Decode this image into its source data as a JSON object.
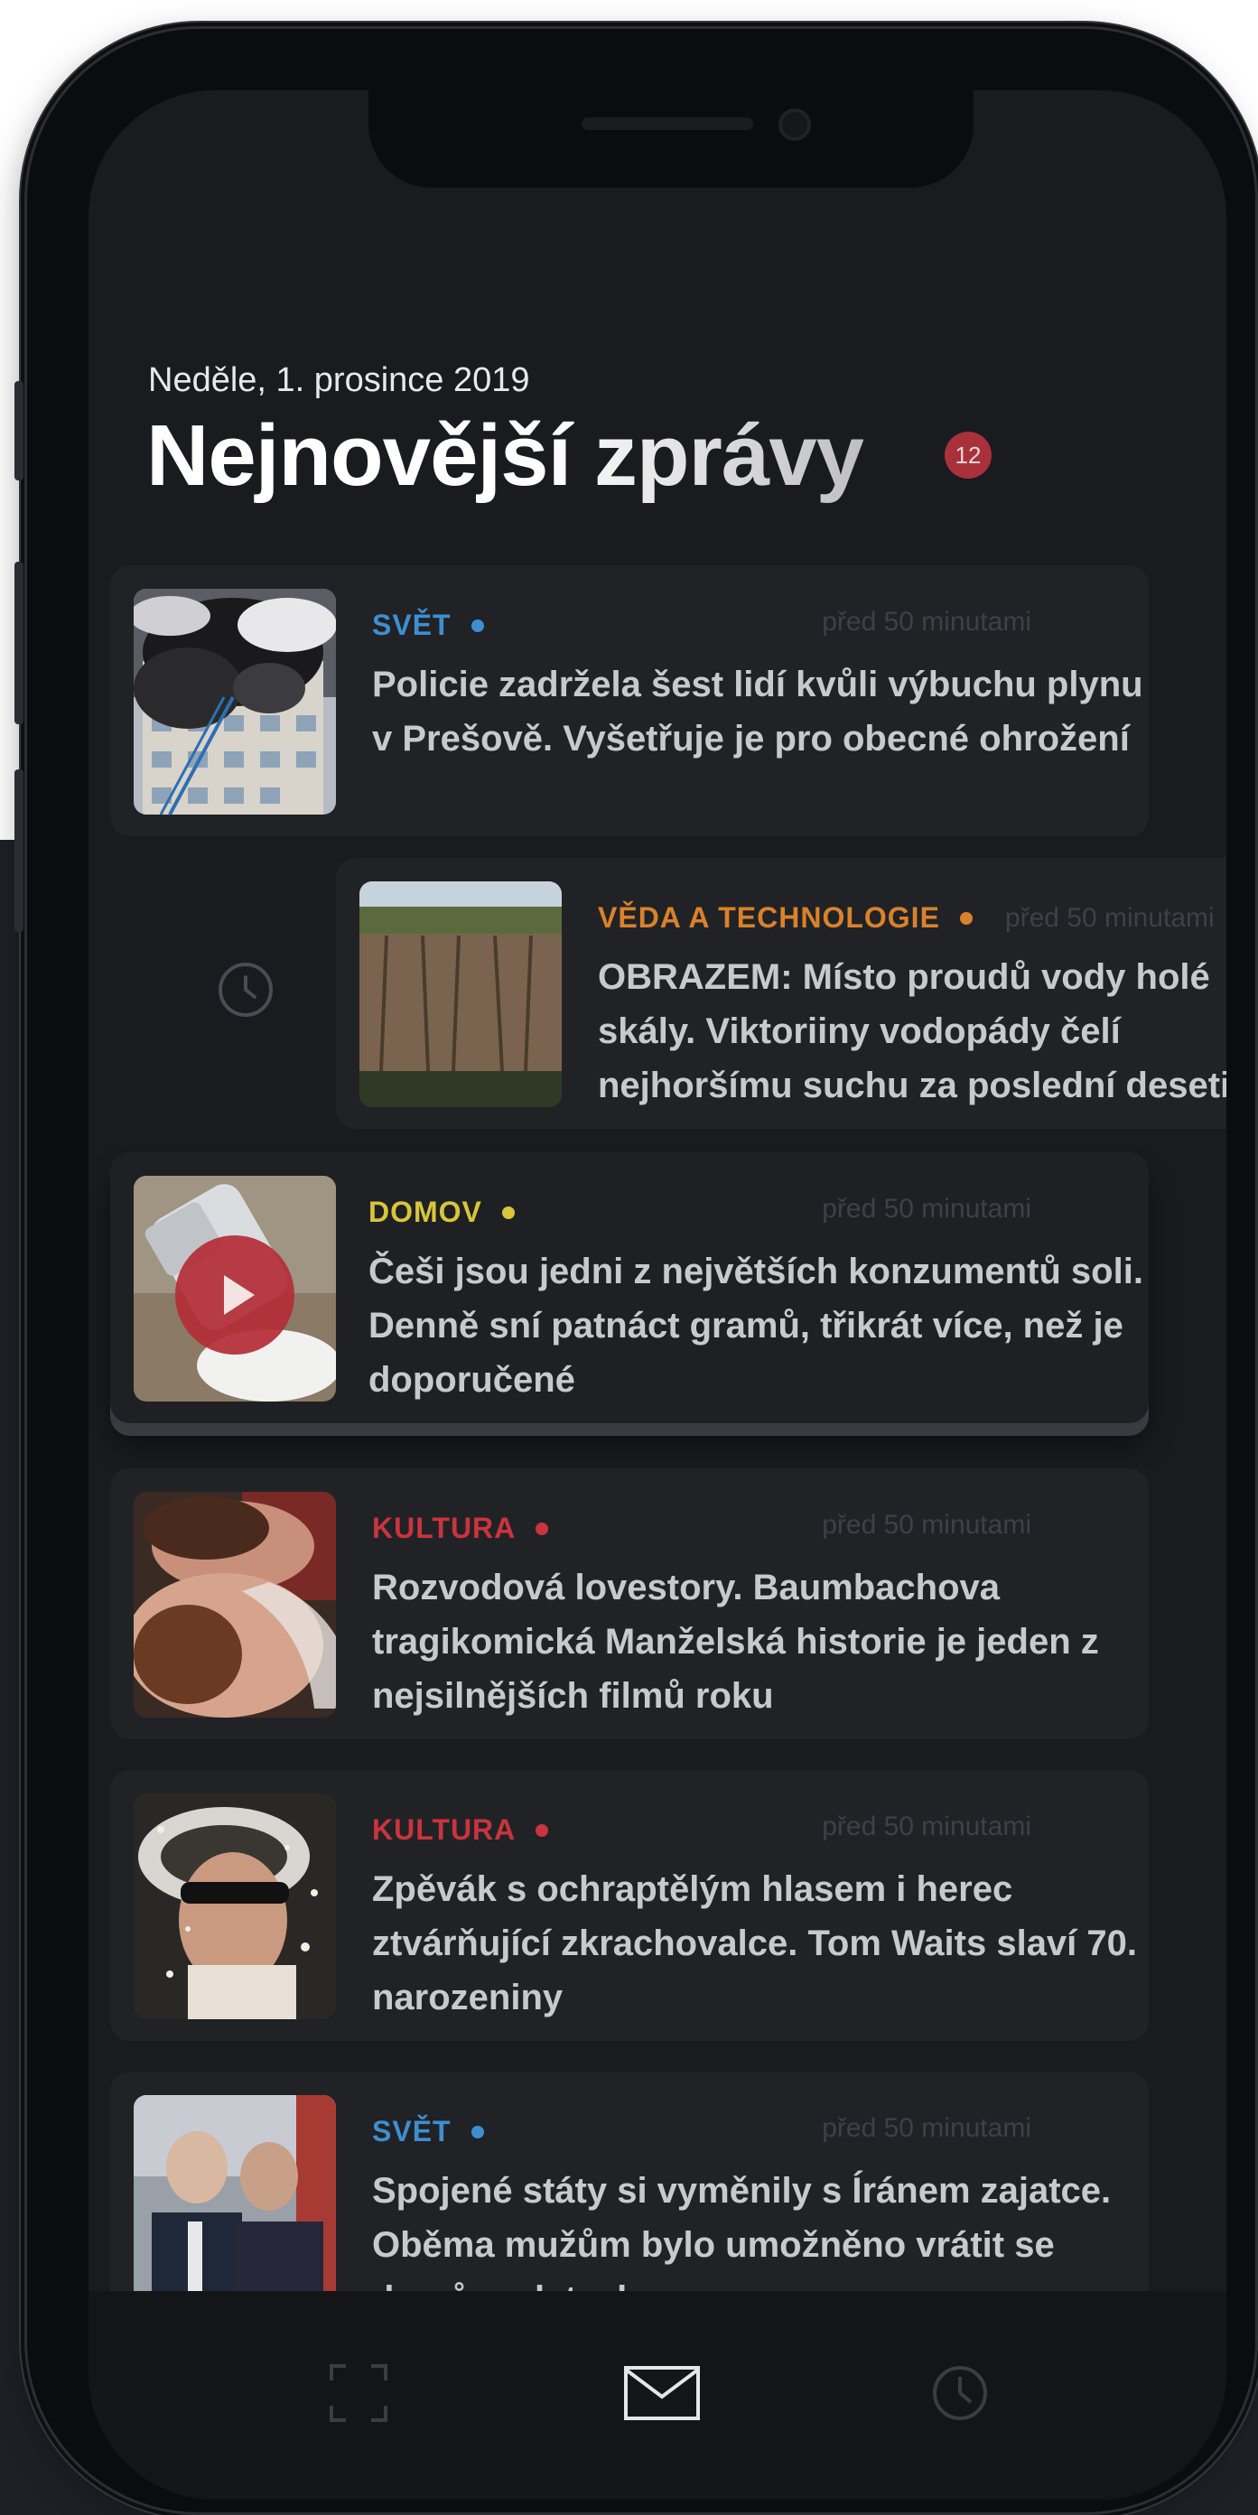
{
  "header": {
    "date": "Neděle, 1. prosince 2019",
    "title": "Nejnovější zprávy",
    "badge_count": "12"
  },
  "articles": [
    {
      "category": "SVĚT",
      "category_color": "#3d8fd0",
      "time": "před 50 minutami",
      "title": "Policie zadržela šest lidí kvůli výbuchu plynu v Prešově. Vyšetřuje je pro obecné ohrožení",
      "icon": "building-fire-photo"
    },
    {
      "category": "VĚDA A TECHNOLOGIE",
      "category_color": "#d9822b",
      "time": "před 50 minutami",
      "title": "OBRAZEM: Místo proudů vody holé skály. Viktoriiny vodopády čelí nejhoršímu suchu za poslední desetiletí",
      "icon": "dry-waterfall-photo"
    },
    {
      "category": "DOMOV",
      "category_color": "#d8c53a",
      "time": "před 50 minutami",
      "title": "Češi jsou jedni z největších konzumentů soli. Denně sní patnáct gramů, třikrát více, než je doporučené",
      "icon": "salt-shaker-photo"
    },
    {
      "category": "KULTURA",
      "category_color": "#c9343e",
      "time": "před 50 minutami",
      "title": "Rozvodová lovestory. Baumbachova tragikomická Manželská historie je jeden z nejsilnějších filmů roku",
      "icon": "film-still-photo"
    },
    {
      "category": "KULTURA",
      "category_color": "#c9343e",
      "time": "před 50 minutami",
      "title": "Zpěvák s ochraptělým hlasem i herec ztvárňující zkrachovalce. Tom Waits slaví 70. narozeniny",
      "icon": "tom-waits-photo"
    },
    {
      "category": "SVĚT",
      "category_color": "#3d8fd0",
      "time": "před 50 minutami",
      "title": "Spojené státy si vyměnily s Íránem zajatce. Oběma mužům bylo umožněno vrátit se domů po letech",
      "icon": "two-men-photo"
    }
  ],
  "tabbar": {
    "items": [
      "scan-icon",
      "mail-icon",
      "clock-icon"
    ],
    "active": "mail-icon"
  }
}
